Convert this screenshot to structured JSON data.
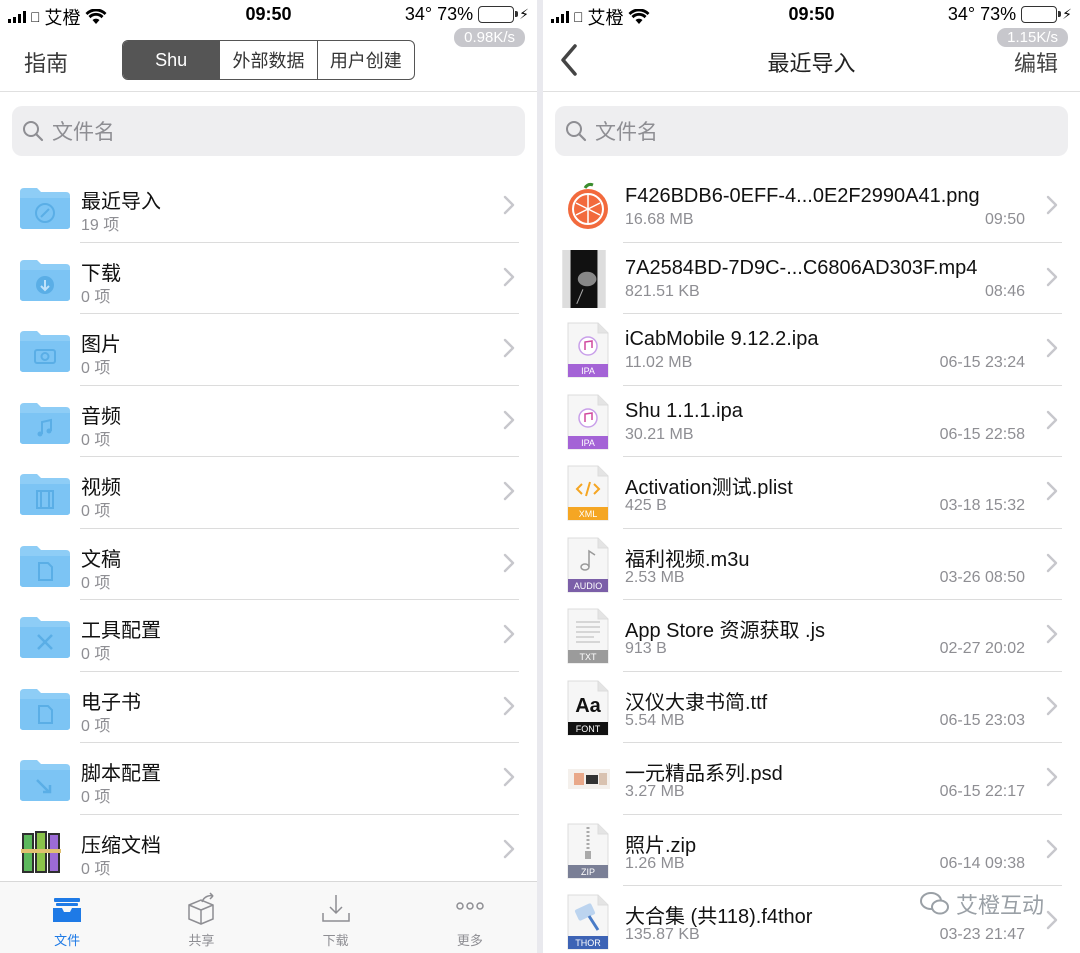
{
  "left": {
    "status": {
      "carrier": "艾橙",
      "time": "09:50",
      "battery_text": "34° 73%",
      "battery_level": 0.73,
      "speed": "0.98K/s"
    },
    "nav": {
      "guide": "指南",
      "segments": [
        "Shu",
        "外部数据",
        "用户创建"
      ],
      "active_segment": "Shu"
    },
    "search": {
      "placeholder": "文件名"
    },
    "folders": [
      {
        "name": "最近导入",
        "count": "19 项",
        "icon": "compass-folder-icon"
      },
      {
        "name": "下载",
        "count": "0 项",
        "icon": "download-folder-icon"
      },
      {
        "name": "图片",
        "count": "0 项",
        "icon": "camera-folder-icon"
      },
      {
        "name": "音频",
        "count": "0 项",
        "icon": "music-folder-icon"
      },
      {
        "name": "视频",
        "count": "0 项",
        "icon": "film-folder-icon"
      },
      {
        "name": "文稿",
        "count": "0 项",
        "icon": "document-folder-icon"
      },
      {
        "name": "工具配置",
        "count": "0 项",
        "icon": "tools-folder-icon"
      },
      {
        "name": "电子书",
        "count": "0 项",
        "icon": "ebook-folder-icon"
      },
      {
        "name": "脚本配置",
        "count": "0 项",
        "icon": "script-folder-icon"
      },
      {
        "name": "压缩文档",
        "count": "0 项",
        "icon": "archive-books-icon"
      }
    ],
    "tabs": [
      {
        "label": "文件",
        "icon": "files-tray-icon"
      },
      {
        "label": "共享",
        "icon": "share-box-icon"
      },
      {
        "label": "下载",
        "icon": "download-icon"
      },
      {
        "label": "更多",
        "icon": "more-dots-icon"
      }
    ],
    "active_tab": "文件"
  },
  "right": {
    "status": {
      "carrier": "艾橙",
      "time": "09:50",
      "battery_text": "34° 73%",
      "battery_level": 0.73,
      "speed": "1.15K/s"
    },
    "nav": {
      "title": "最近导入",
      "edit": "编辑"
    },
    "search": {
      "placeholder": "文件名"
    },
    "files": [
      {
        "name": "F426BDB6-0EFF-4...0E2F2990A41.png",
        "size": "16.68 MB",
        "time": "09:50",
        "icon": "orange-image-thumb",
        "badge": ""
      },
      {
        "name": "7A2584BD-7D9C-...C6806AD303F.mp4",
        "size": "821.51 KB",
        "time": "08:46",
        "icon": "video-thumb",
        "badge": ""
      },
      {
        "name": "iCabMobile 9.12.2.ipa",
        "size": "11.02 MB",
        "time": "06-15 23:24",
        "icon": "ipa-music-icon",
        "badge": "IPA"
      },
      {
        "name": "Shu 1.1.1.ipa",
        "size": "30.21 MB",
        "time": "06-15 22:58",
        "icon": "ipa-music-icon",
        "badge": "IPA"
      },
      {
        "name": "Activation测试.plist",
        "size": "425 B",
        "time": "03-18 15:32",
        "icon": "xml-code-icon",
        "badge": "XML"
      },
      {
        "name": "福利视频.m3u",
        "size": "2.53 MB",
        "time": "03-26 08:50",
        "icon": "audio-note-icon",
        "badge": "AUDIO"
      },
      {
        "name": "App Store 资源获取 .js",
        "size": "913 B",
        "time": "02-27 20:02",
        "icon": "txt-file-icon",
        "badge": "TXT"
      },
      {
        "name": "汉仪大隶书简.ttf",
        "size": "5.54 MB",
        "time": "06-15 23:03",
        "icon": "font-aa-icon",
        "badge": "FONT"
      },
      {
        "name": "一元精品系列.psd",
        "size": "3.27 MB",
        "time": "06-15 22:17",
        "icon": "psd-thumb",
        "badge": ""
      },
      {
        "name": "照片.zip",
        "size": "1.26 MB",
        "time": "06-14 09:38",
        "icon": "zip-file-icon",
        "badge": "ZIP"
      },
      {
        "name": "大合集 (共118).f4thor",
        "size": "135.87 KB",
        "time": "03-23 21:47",
        "icon": "thor-file-icon",
        "badge": "THOR"
      }
    ]
  },
  "watermark": "艾橙互动",
  "colors": {
    "accent": "#1e7ae6",
    "folder": "#7cc4f4",
    "badge_ipa": "#a463d6",
    "badge_xml": "#f5a623",
    "badge_audio": "#7b5fa8",
    "badge_txt": "#9b9b9b",
    "badge_font": "#111111",
    "badge_zip": "#7a7f96",
    "badge_thor": "#3d63b5"
  }
}
